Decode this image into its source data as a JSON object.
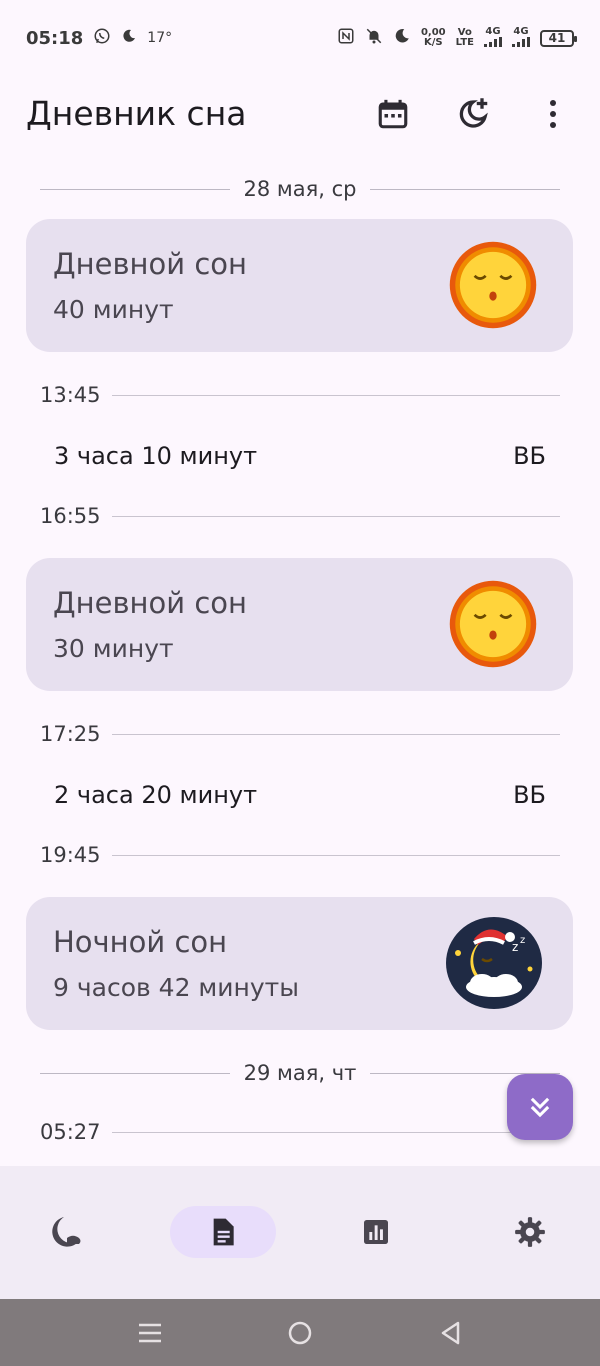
{
  "status_bar": {
    "time": "05:18",
    "temperature": "17°",
    "net_speed_value": "0,00",
    "net_speed_unit": "K/S",
    "volte_top": "Vo",
    "volte_bottom": "LTE",
    "signal1": "4G",
    "signal2": "4G",
    "battery": "41"
  },
  "app_bar": {
    "title": "Дневник сна",
    "icons": [
      "calendar-icon",
      "add-sleep-icon",
      "more-vert-icon"
    ]
  },
  "timeline": {
    "date1": "28 мая, ср",
    "card1": {
      "title": "Дневной сон",
      "duration": "40 минут",
      "emoji": "sleeping-sun"
    },
    "time1": "13:45",
    "awake1": {
      "duration": "3 часа 10 минут",
      "tag": "ВБ"
    },
    "time2": "16:55",
    "card2": {
      "title": "Дневной сон",
      "duration": "30 минут",
      "emoji": "sleeping-sun"
    },
    "time3": "17:25",
    "awake2": {
      "duration": "2 часа 20 минут",
      "tag": "ВБ"
    },
    "time4": "19:45",
    "card3": {
      "title": "Ночной сон",
      "duration": "9 часов 42 минуты",
      "emoji": "sleeping-moon"
    },
    "date2": "29 мая, чт",
    "time5": "05:27"
  },
  "fab": {
    "icon": "double-chevron-down-icon"
  },
  "bottom_nav": {
    "items": [
      {
        "icon": "moon-icon",
        "active": false
      },
      {
        "icon": "diary-icon",
        "active": true
      },
      {
        "icon": "stats-icon",
        "active": false
      },
      {
        "icon": "settings-icon",
        "active": false
      }
    ]
  },
  "colors": {
    "background": "#fdf7fe",
    "card": "#e7e0ef",
    "fab": "#8e6bc8",
    "nav_active": "#e8ddfb"
  }
}
